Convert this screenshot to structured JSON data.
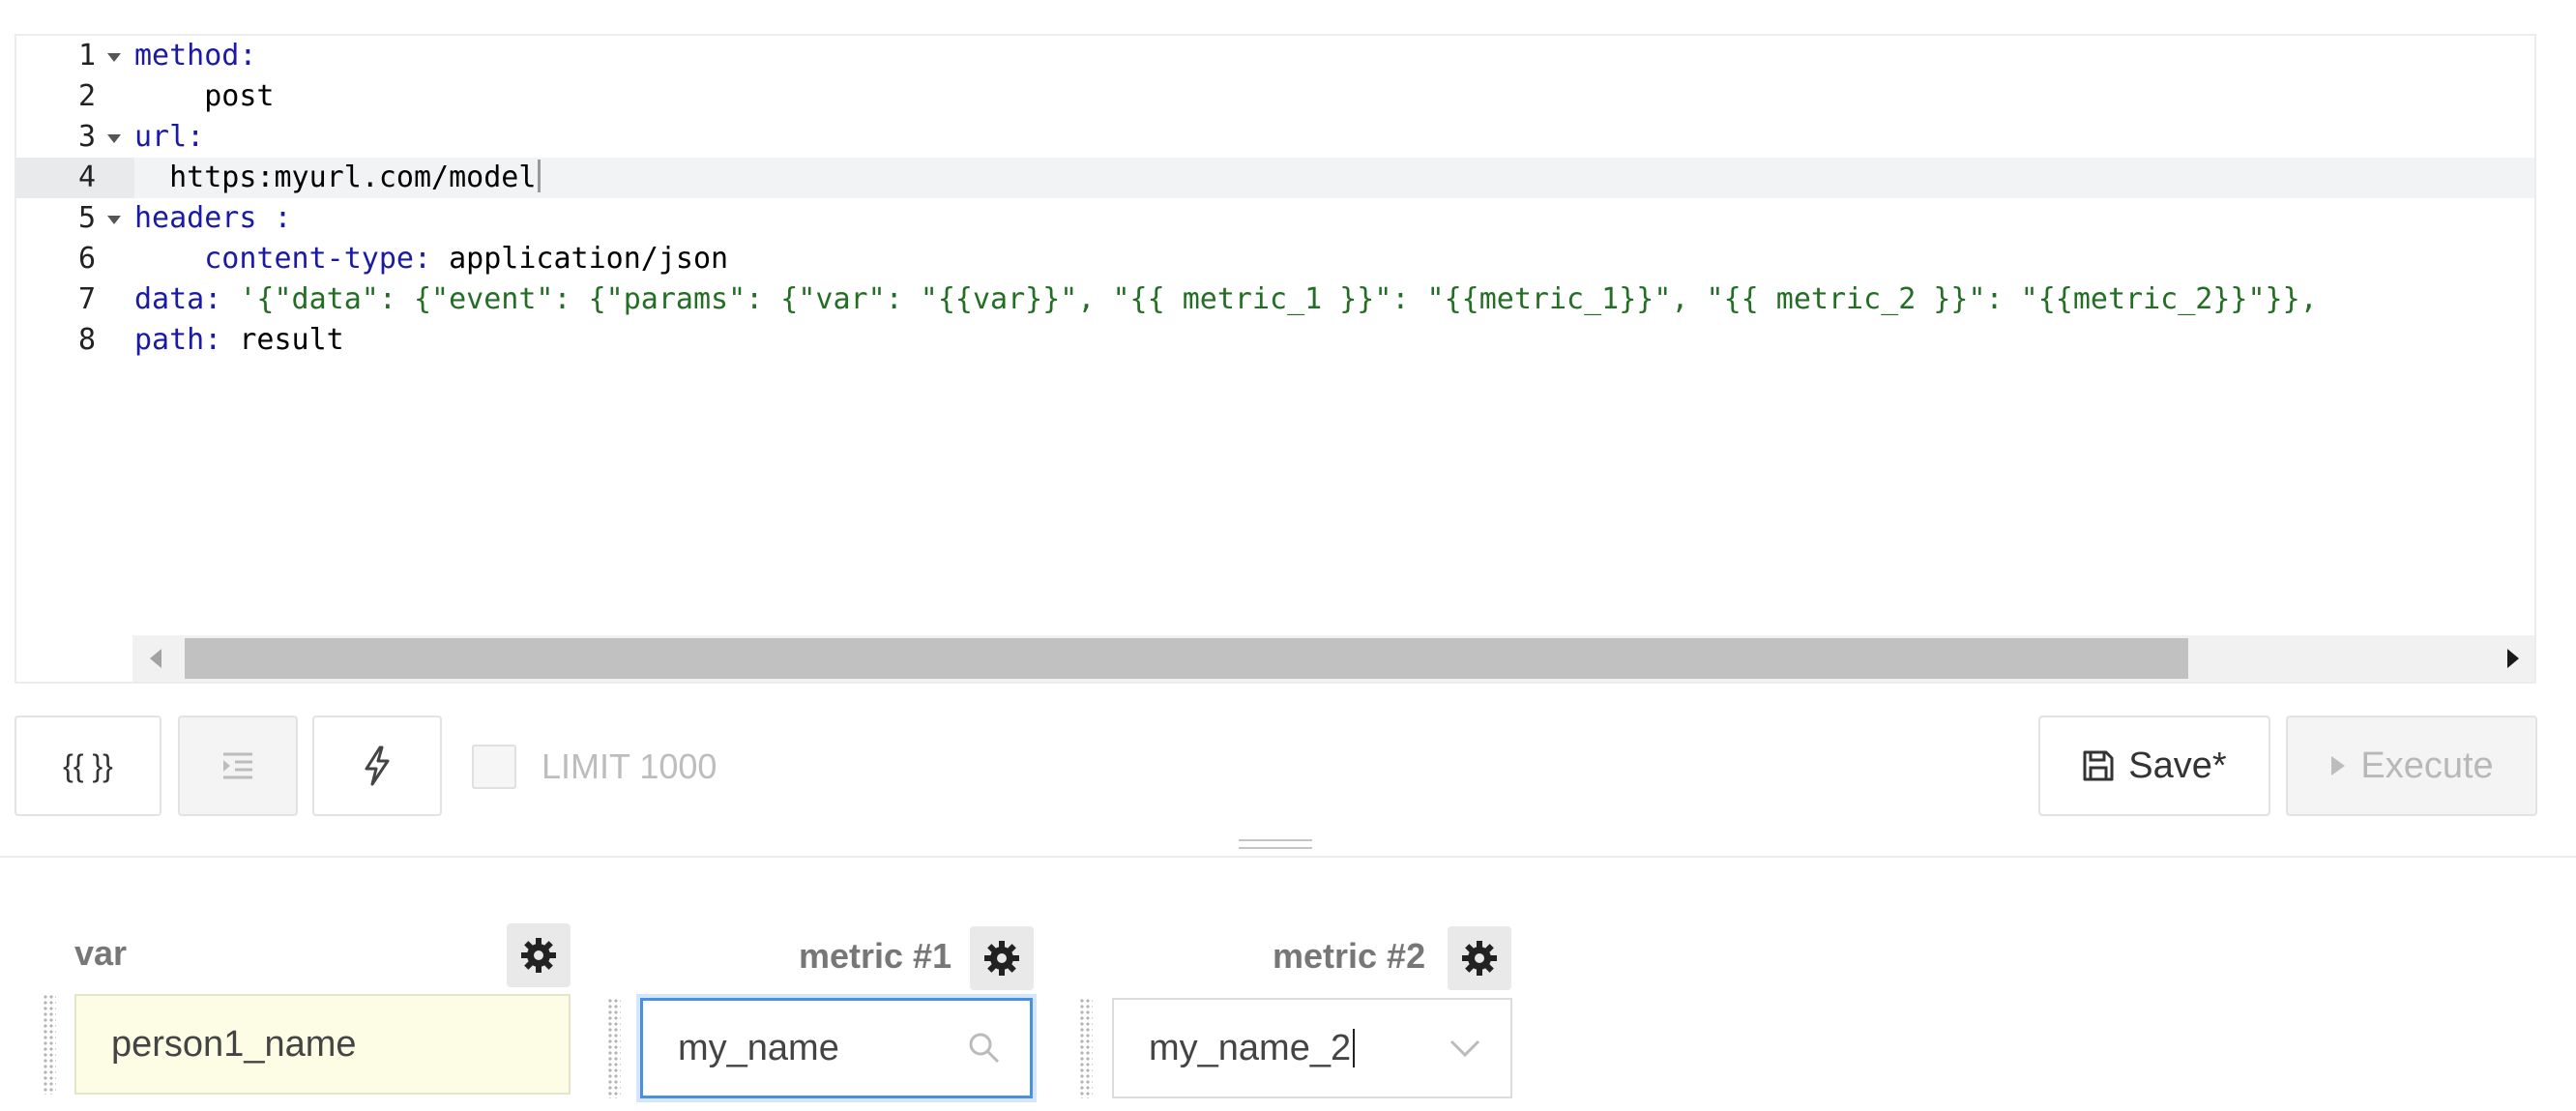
{
  "editor": {
    "lines": [
      {
        "num": "1",
        "fold": true,
        "indent": "",
        "key": "method:",
        "value": ""
      },
      {
        "num": "2",
        "fold": false,
        "indent": "    ",
        "key": "",
        "value": "post"
      },
      {
        "num": "3",
        "fold": true,
        "indent": "",
        "key": "url:",
        "value": ""
      },
      {
        "num": "4",
        "fold": false,
        "indent": "  ",
        "key": "",
        "value": "https:myurl.com/model"
      },
      {
        "num": "5",
        "fold": true,
        "indent": "",
        "key": "headers :",
        "value": ""
      },
      {
        "num": "6",
        "fold": false,
        "indent": "    ",
        "key": "content-type:",
        "value": " application/json"
      },
      {
        "num": "7",
        "fold": false,
        "indent": "",
        "key": "data:",
        "string": " '{\"data\": {\"event\": {\"params\": {\"var\": \"{{var}}\", \"{{ metric_1 }}\": \"{{metric_1}}\", \"{{ metric_2 }}\": \"{{metric_2}}\"}},"
      },
      {
        "num": "8",
        "fold": false,
        "indent": "",
        "key": "path:",
        "value": " result"
      }
    ],
    "active_line": 4
  },
  "toolbar": {
    "template_btn": "{{ }}",
    "limit_label": "LIMIT 1000",
    "save_label": "Save*",
    "execute_label": "Execute"
  },
  "params": [
    {
      "label": "var",
      "value": "person1_name"
    },
    {
      "label": "metric #1",
      "value": "my_name"
    },
    {
      "label": "metric #2",
      "value": "my_name_2"
    }
  ]
}
